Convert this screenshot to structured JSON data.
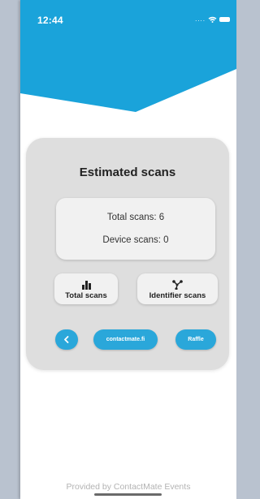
{
  "status_bar": {
    "time": "12:44",
    "dots": "....",
    "wifi_icon": "wifi-icon",
    "battery_icon": "battery-icon"
  },
  "colors": {
    "accent": "#1aa3da",
    "card": "#dedede",
    "button": "#2aa7da"
  },
  "card": {
    "title": "Estimated scans",
    "total_scans_line": "Total scans: 6",
    "device_scans_line": "Device scans: 0"
  },
  "tiles": {
    "total_scans": {
      "icon": "bar-chart-icon",
      "label": "Total scans"
    },
    "identifier_scans": {
      "icon": "network-icon",
      "label": "Identifier scans"
    }
  },
  "buttons": {
    "back": {
      "icon": "chevron-left-icon",
      "label": "<"
    },
    "site": {
      "label": "contactmate.fi"
    },
    "raffle": {
      "label": "Raffle"
    }
  },
  "footer": {
    "text": "Provided by ContactMate Events"
  }
}
